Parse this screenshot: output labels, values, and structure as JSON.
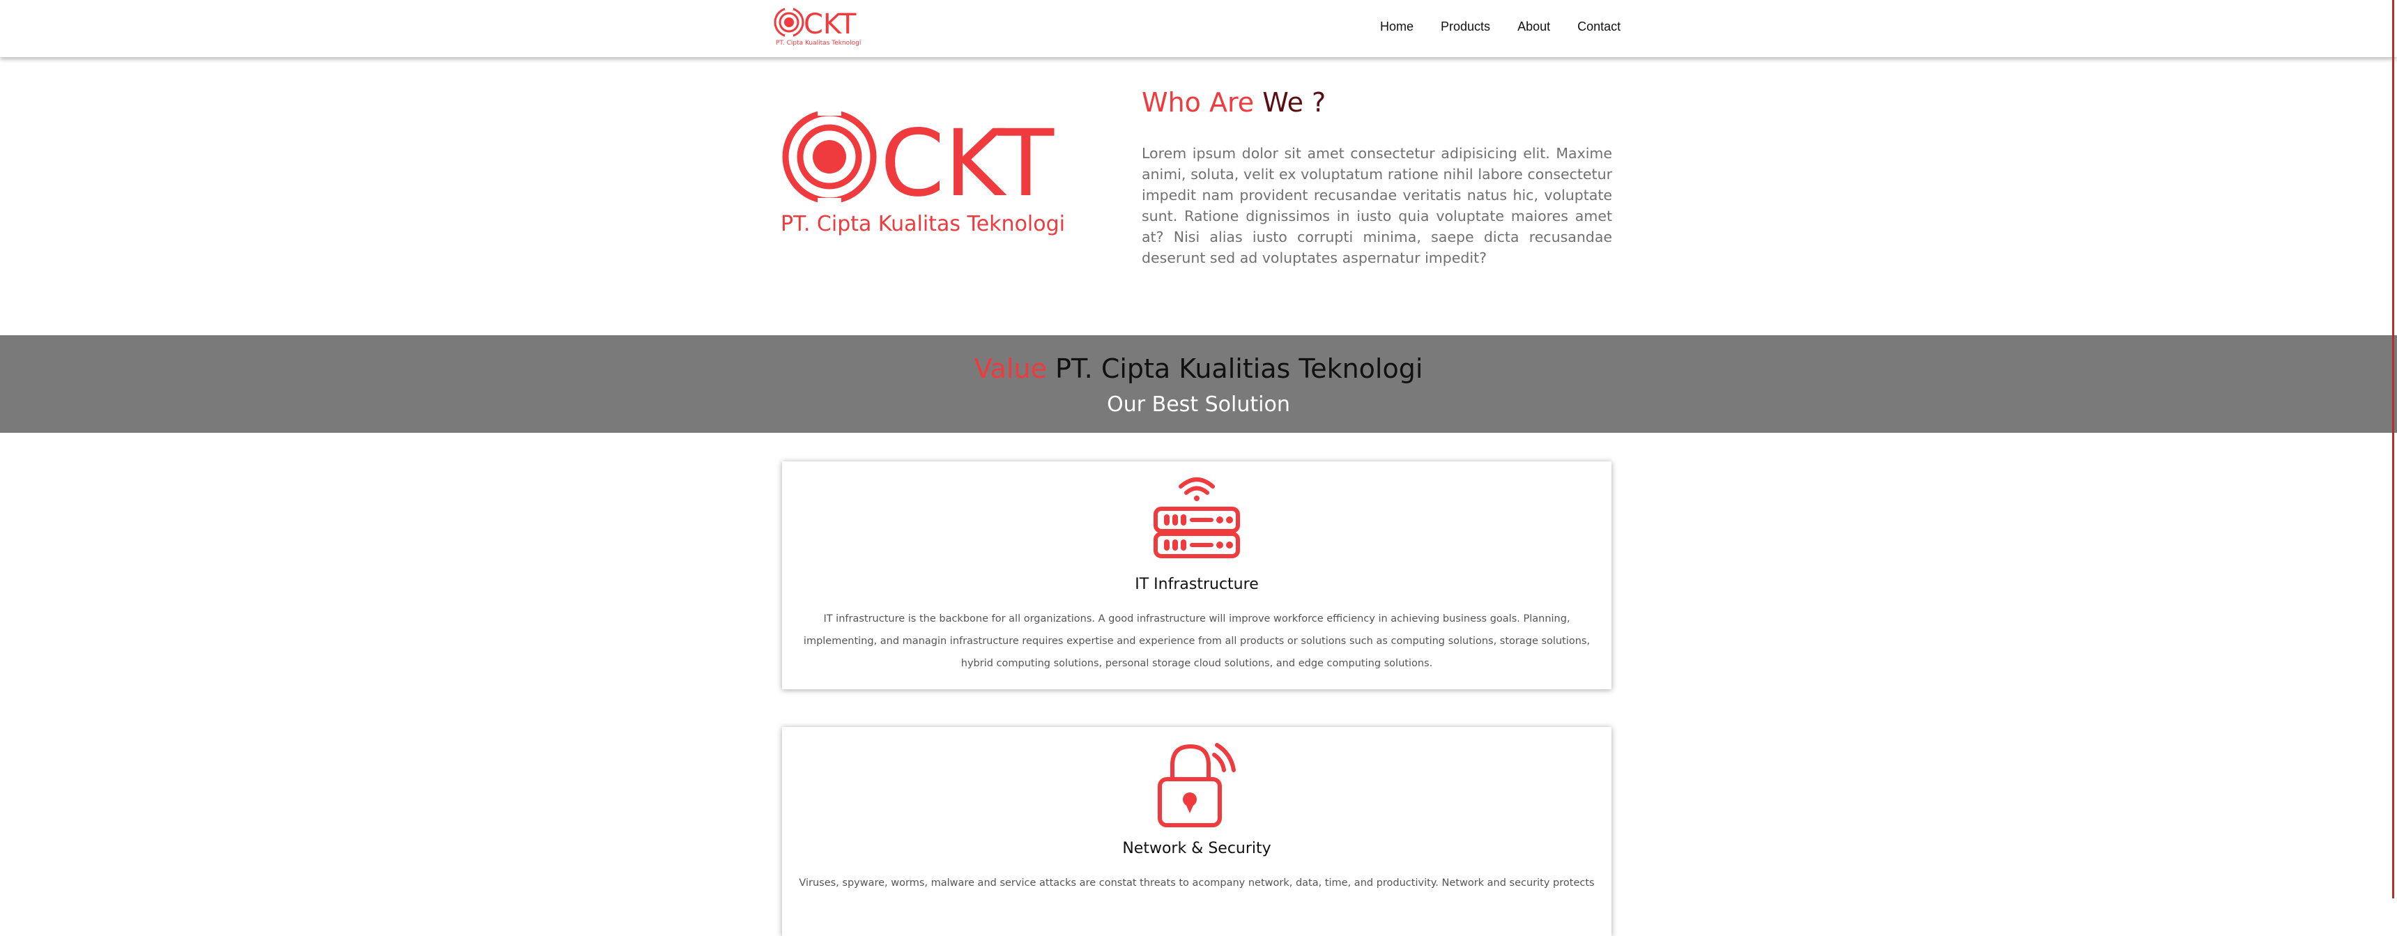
{
  "colors": {
    "accent": "#ef3a3e",
    "dark_red": "#5a0e12",
    "band": "#7a7a7a"
  },
  "navbar": {
    "logo_text": "CKT",
    "logo_tagline": "PT. Cipta Kualitas Teknologi",
    "links": [
      "Home",
      "Products",
      "About",
      "Contact"
    ]
  },
  "hero": {
    "logo_text": "CKT",
    "tagline": "PT. Cipta Kualitas Teknologi",
    "title_part1": "Who Are ",
    "title_part2": "We ?",
    "body": "Lorem ipsum dolor sit amet consectetur adipisicing elit. Maxime animi, soluta, velit ex voluptatum ratione nihil labore consectetur impedit nam provident recusandae veritatis natus hic, voluptate sunt. Ratione dignissimos in iusto quia voluptate maiores amet at? Nisi alias iusto corrupti minima, saepe dicta recusandae deserunt sed ad voluptates aspernatur impedit?"
  },
  "band": {
    "title_highlight": "Value",
    "title_rest": " PT. Cipta Kualitias Teknologi",
    "subtitle": "Our Best Solution"
  },
  "services": [
    {
      "icon": "server-wifi-icon",
      "title": "IT Infrastructure",
      "text": "IT infrastructure is the backbone for all organizations. A good infrastructure will improve workforce efficiency in achieving business goals. Planning, implementing, and managin infrastructure requires expertise and experience from all products or solutions such as computing solutions, storage solutions, hybrid computing solutions, personal storage cloud solutions, and edge computing solutions."
    },
    {
      "icon": "lock-signal-icon",
      "title": "Network & Security",
      "text": "Viruses, spyware, worms, malware and service attacks are constat threats to acompany network, data, time, and productivity. Network and security protects"
    }
  ]
}
